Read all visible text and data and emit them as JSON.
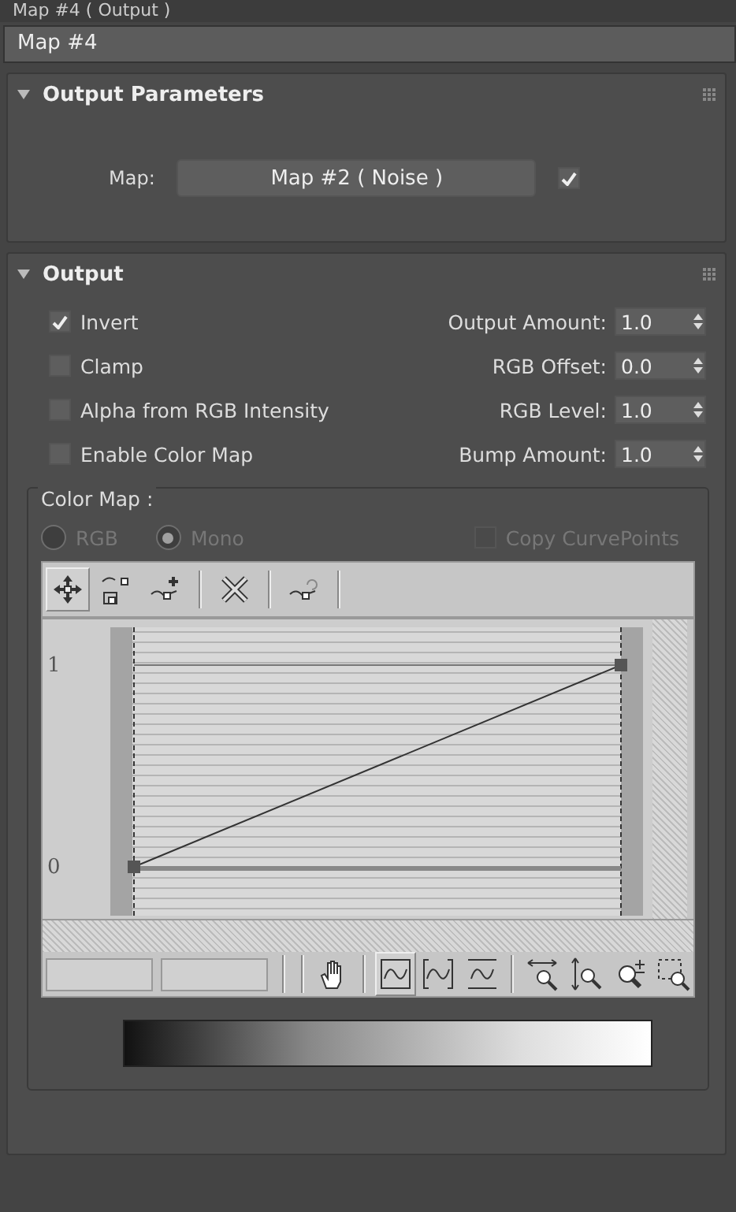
{
  "window": {
    "title": "Map #4 ( Output )"
  },
  "name_field": {
    "value": "Map #4"
  },
  "output_parameters": {
    "title": "Output Parameters",
    "expanded": true,
    "map_label": "Map:",
    "map_button": "Map #2 ( Noise )",
    "map_enabled": true
  },
  "output": {
    "title": "Output",
    "expanded": true,
    "checkboxes": [
      {
        "label": "Invert",
        "checked": true
      },
      {
        "label": "Clamp",
        "checked": false
      },
      {
        "label": "Alpha from RGB Intensity",
        "checked": false
      },
      {
        "label": "Enable Color Map",
        "checked": false
      }
    ],
    "spinners": [
      {
        "label": "Output Amount:",
        "value": "1.0"
      },
      {
        "label": "RGB Offset:",
        "value": "0.0"
      },
      {
        "label": "RGB Level:",
        "value": "1.0"
      },
      {
        "label": "Bump Amount:",
        "value": "1.0"
      }
    ],
    "color_map": {
      "title": "Color Map :",
      "disabled": true,
      "modes": [
        {
          "label": "RGB",
          "selected": false
        },
        {
          "label": "Mono",
          "selected": true
        }
      ],
      "copy_curve_points": {
        "label": "Copy CurvePoints",
        "checked": false
      },
      "toolbar": [
        {
          "kind": "move",
          "selected": true
        },
        {
          "kind": "scale",
          "selected": false
        },
        {
          "kind": "add",
          "selected": false
        },
        {
          "kind": "separator"
        },
        {
          "kind": "delete",
          "selected": false
        },
        {
          "kind": "separator"
        },
        {
          "kind": "reset",
          "selected": false
        },
        {
          "kind": "separator"
        }
      ],
      "axis_labels": [
        "1",
        "0"
      ],
      "bottom_toolbar": [
        {
          "kind": "field"
        },
        {
          "kind": "field"
        },
        {
          "kind": "separator"
        },
        {
          "kind": "separator"
        },
        {
          "kind": "pan",
          "selected": false
        },
        {
          "kind": "separator"
        },
        {
          "kind": "curve",
          "selected": true
        },
        {
          "kind": "curve-bracket",
          "selected": false
        },
        {
          "kind": "curve-lines",
          "selected": false
        },
        {
          "kind": "separator"
        },
        {
          "kind": "zoom-horizontal",
          "selected": false
        },
        {
          "kind": "zoom-vertical",
          "selected": false
        },
        {
          "kind": "zoom",
          "selected": false
        },
        {
          "kind": "zoom-region",
          "selected": false
        }
      ]
    }
  }
}
